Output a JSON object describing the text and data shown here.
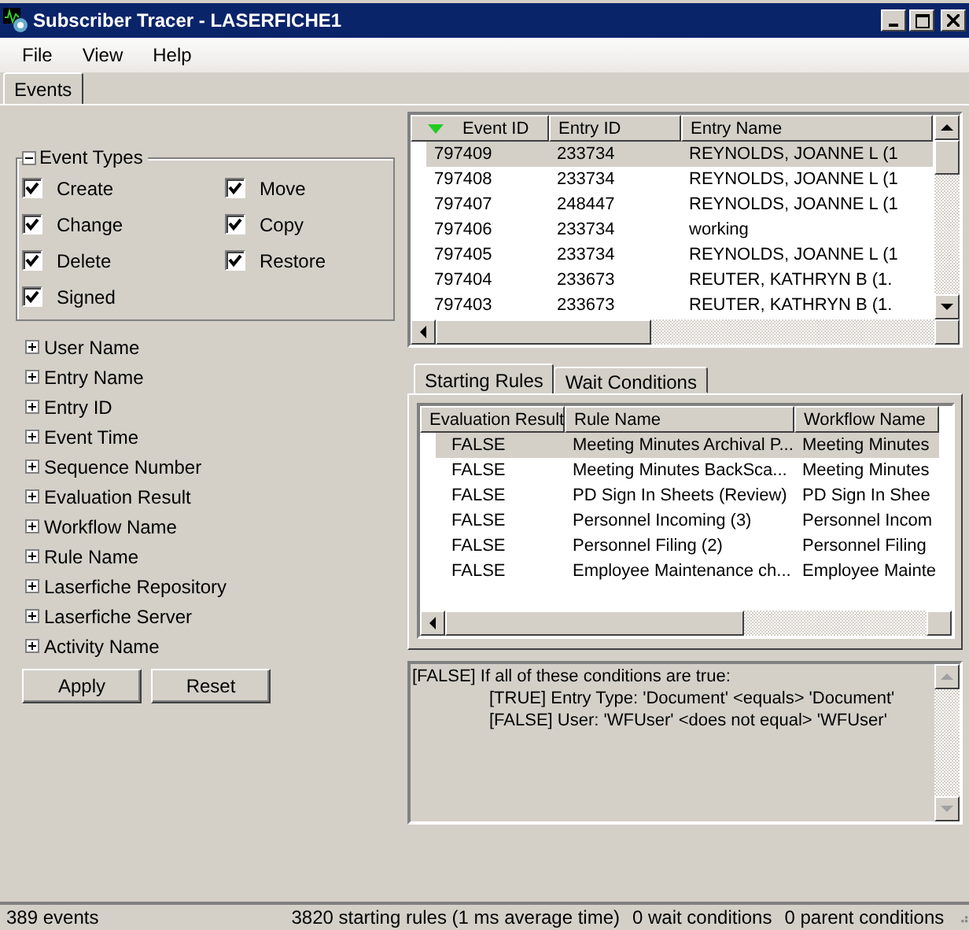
{
  "window": {
    "title": "Subscriber Tracer - LASERFICHE1"
  },
  "menu": [
    "File",
    "View",
    "Help"
  ],
  "tabs": [
    {
      "label": "Events",
      "selected": true
    }
  ],
  "event_types": {
    "label": "Event Types",
    "expanded": true,
    "items": [
      {
        "label": "Create",
        "checked": true
      },
      {
        "label": "Move",
        "checked": true
      },
      {
        "label": "Change",
        "checked": true
      },
      {
        "label": "Copy",
        "checked": true
      },
      {
        "label": "Delete",
        "checked": true
      },
      {
        "label": "Restore",
        "checked": true
      },
      {
        "label": "Signed",
        "checked": true
      }
    ]
  },
  "filters": [
    {
      "label": "User Name",
      "expanded": false
    },
    {
      "label": "Entry Name",
      "expanded": false
    },
    {
      "label": "Entry ID",
      "expanded": false
    },
    {
      "label": "Event Time",
      "expanded": false
    },
    {
      "label": "Sequence Number",
      "expanded": false
    },
    {
      "label": "Evaluation Result",
      "expanded": false
    },
    {
      "label": "Workflow Name",
      "expanded": false
    },
    {
      "label": "Rule Name",
      "expanded": false
    },
    {
      "label": "Laserfiche Repository",
      "expanded": false
    },
    {
      "label": "Laserfiche Server",
      "expanded": false
    },
    {
      "label": "Activity Name",
      "expanded": false
    }
  ],
  "buttons": [
    "Apply",
    "Reset"
  ],
  "events_table": {
    "columns": [
      "Event ID",
      "Entry ID",
      "Entry Name"
    ],
    "rows": [
      {
        "cells": [
          "797409",
          "233734",
          "REYNOLDS, JOANNE L (1"
        ],
        "selected": true
      },
      {
        "cells": [
          "797408",
          "233734",
          "REYNOLDS, JOANNE L (1"
        ],
        "selected": false
      },
      {
        "cells": [
          "797407",
          "248447",
          "REYNOLDS, JOANNE L (1"
        ],
        "selected": false
      },
      {
        "cells": [
          "797406",
          "233734",
          "working"
        ],
        "selected": false
      },
      {
        "cells": [
          "797405",
          "233734",
          "REYNOLDS, JOANNE L (1"
        ],
        "selected": false
      },
      {
        "cells": [
          "797404",
          "233673",
          "REUTER, KATHRYN B (1."
        ],
        "selected": false
      },
      {
        "cells": [
          "797403",
          "233673",
          "REUTER, KATHRYN B (1."
        ],
        "selected": false
      }
    ]
  },
  "detail_tabs": [
    {
      "label": "Starting Rules",
      "selected": true
    },
    {
      "label": "Wait Conditions",
      "selected": false
    }
  ],
  "rules_table": {
    "columns": [
      "Evaluation Result",
      "Rule Name",
      "Workflow Name"
    ],
    "rows": [
      {
        "cells": [
          "FALSE",
          "Meeting Minutes Archival P...",
          "Meeting Minutes"
        ],
        "selected": true
      },
      {
        "cells": [
          "FALSE",
          "Meeting Minutes BackSca...",
          "Meeting Minutes"
        ],
        "selected": false
      },
      {
        "cells": [
          "FALSE",
          "PD Sign In Sheets (Review)",
          "PD Sign In Shee"
        ],
        "selected": false
      },
      {
        "cells": [
          "FALSE",
          "Personnel Incoming (3)",
          "Personnel Incom"
        ],
        "selected": false
      },
      {
        "cells": [
          "FALSE",
          "Personnel Filing (2)",
          "Personnel Filing"
        ],
        "selected": false
      },
      {
        "cells": [
          "FALSE",
          "Employee Maintenance ch...",
          "Employee Mainte"
        ],
        "selected": false
      }
    ]
  },
  "conditions": [
    {
      "text": "[FALSE] If all of these conditions are true:",
      "children": [
        {
          "text": "[TRUE] Entry Type: 'Document' <equals> 'Document'"
        },
        {
          "text": "[FALSE] User: 'WFUser' <does not equal> 'WFUser'"
        }
      ]
    }
  ],
  "status_bar": [
    "389 events",
    "3820 starting rules (1 ms average time)",
    "0 wait conditions",
    "0 parent conditions"
  ]
}
